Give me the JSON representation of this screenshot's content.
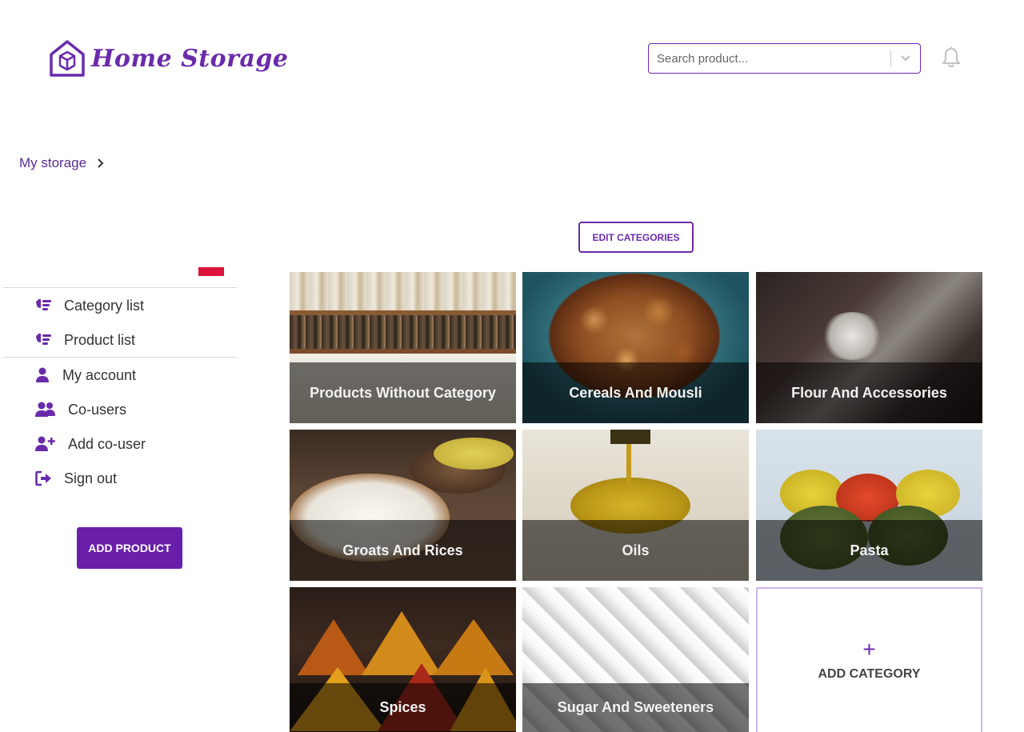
{
  "header": {
    "brand": "Home Storage",
    "search_placeholder": "Search product..."
  },
  "breadcrumb": {
    "label": "My storage"
  },
  "toolbar": {
    "edit_categories_label": "EDIT CATEGORIES"
  },
  "sidebar": {
    "items": [
      {
        "label": "Category list",
        "icon": "list-hand-icon"
      },
      {
        "label": "Product list",
        "icon": "list-hand-icon"
      },
      {
        "label": "My account",
        "icon": "user-icon"
      },
      {
        "label": "Co-users",
        "icon": "users-icon"
      },
      {
        "label": "Add co-user",
        "icon": "user-plus-icon"
      },
      {
        "label": "Sign out",
        "icon": "sign-out-icon"
      }
    ],
    "add_product_label": "ADD PRODUCT"
  },
  "categories": [
    {
      "name": "Products Without Category"
    },
    {
      "name": "Cereals And Mousli"
    },
    {
      "name": "Flour And Accessories"
    },
    {
      "name": "Groats And Rices"
    },
    {
      "name": "Oils"
    },
    {
      "name": "Pasta"
    },
    {
      "name": "Spices"
    },
    {
      "name": "Sugar And Sweeteners"
    }
  ],
  "add_category": {
    "plus": "+",
    "label": "ADD CATEGORY"
  },
  "colors": {
    "accent": "#6a2bab",
    "button": "#6a1fab",
    "flag": "#dc143c"
  }
}
